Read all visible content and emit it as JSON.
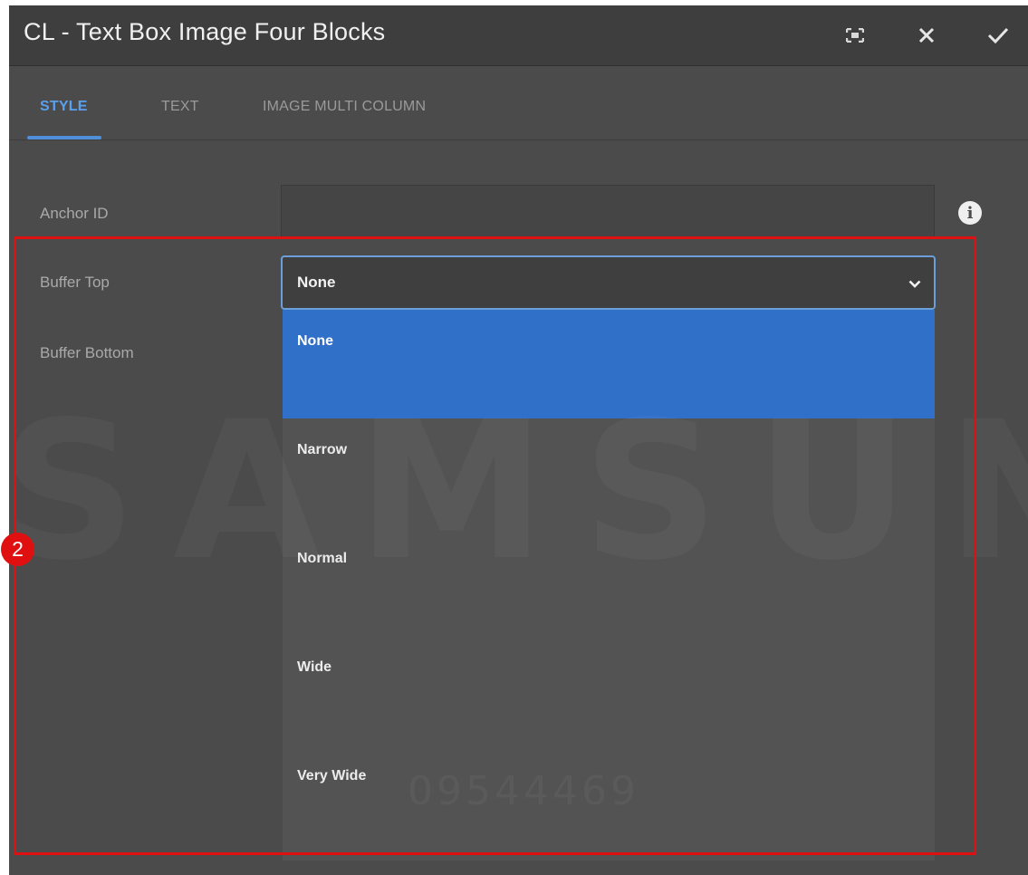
{
  "dialog": {
    "title": "CL - Text Box Image Four Blocks"
  },
  "tabs": [
    {
      "label": "STYLE",
      "active": true
    },
    {
      "label": "TEXT",
      "active": false
    },
    {
      "label": "IMAGE MULTI COLUMN",
      "active": false
    }
  ],
  "form": {
    "anchor_id": {
      "label": "Anchor ID",
      "value": ""
    },
    "buffer_top": {
      "label": "Buffer Top",
      "value": "None"
    },
    "buffer_bottom": {
      "label": "Buffer Bottom"
    }
  },
  "dropdown": {
    "options": [
      "None",
      "Narrow",
      "Normal",
      "Wide",
      "Very Wide"
    ],
    "selected": "None"
  },
  "annotation": {
    "badge": "2",
    "color": "#e01010"
  },
  "watermark": {
    "brand": "SAMSUNG",
    "code": "09544469"
  },
  "colors": {
    "dialog_bg": "#4b4b4b",
    "titlebar_bg": "#3e3e3e",
    "accent": "#5aa0ef",
    "selected_option": "#3170c9"
  },
  "icons": {
    "fullscreen": "fullscreen-icon",
    "close": "close-icon",
    "confirm": "check-icon",
    "info": "info-icon",
    "chevron": "chevron-down-icon"
  }
}
